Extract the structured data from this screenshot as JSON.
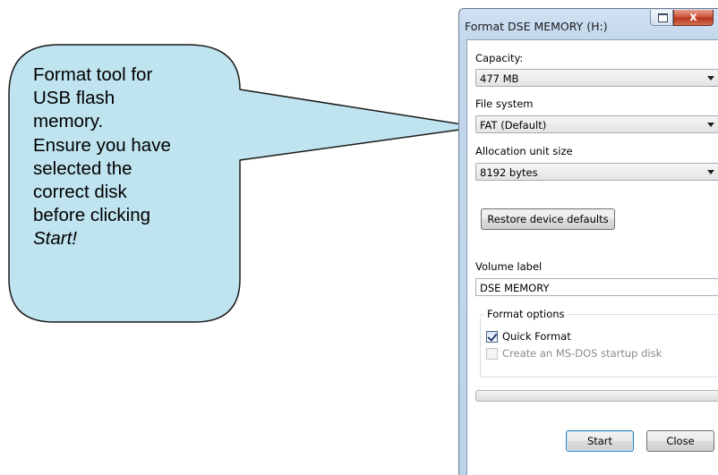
{
  "callout": {
    "lines": [
      "Format tool for",
      "USB flash",
      "memory.",
      "Ensure you have",
      "selected the",
      "correct disk",
      "before clicking",
      "Start!"
    ],
    "fill_color": "#bfe3ef",
    "border_color": "#1a1a1a"
  },
  "window": {
    "title": "Format DSE MEMORY (H:)",
    "restore_icon": "restore-icon",
    "close_icon": "close-icon",
    "close_glyph": "x"
  },
  "dialog": {
    "capacity": {
      "label": "Capacity:",
      "value": "477 MB"
    },
    "file_system": {
      "label": "File system",
      "value": "FAT (Default)"
    },
    "allocation": {
      "label": "Allocation unit size",
      "value": "8192 bytes"
    },
    "restore_defaults_label": "Restore device defaults",
    "volume_label": {
      "label": "Volume label",
      "value": "DSE MEMORY"
    },
    "format_options": {
      "title": "Format options",
      "quick_format": {
        "label": "Quick Format",
        "checked": true,
        "enabled": true
      },
      "ms_dos": {
        "label": "Create an MS-DOS startup disk",
        "checked": false,
        "enabled": false
      }
    },
    "progress": 0,
    "start_label": "Start",
    "close_label": "Close"
  },
  "colors": {
    "window_frame": "#c2d7ec",
    "close_button": "#c9503a",
    "disabled_text": "#8a8a8a"
  }
}
